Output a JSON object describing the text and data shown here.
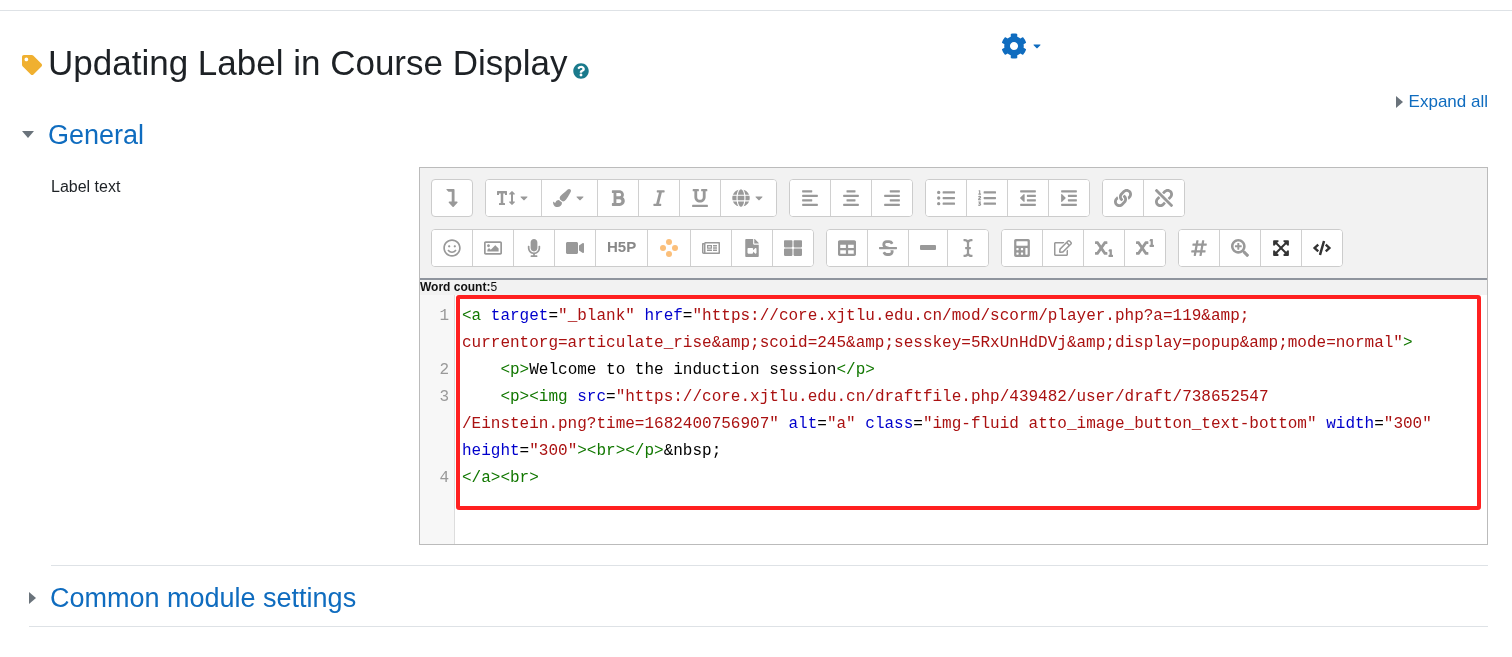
{
  "page": {
    "title": "Updating Label in Course Display"
  },
  "expand_all": "Expand all",
  "sections": [
    {
      "title": "General",
      "expanded": true,
      "fields": [
        {
          "label": "Label text",
          "editor": {
            "h5p_label": "H5P",
            "word_count_label": "Word count:",
            "word_count": "5",
            "highlighted": true,
            "code_lines": [
              {
                "number": "1",
                "rows": [
                  {
                    "tokens": [
                      {
                        "kind": "tag",
                        "text": "<a"
                      },
                      {
                        "kind": "attr",
                        "text": " target"
                      },
                      {
                        "kind": "text",
                        "text": "="
                      },
                      {
                        "kind": "value",
                        "text": "\"_blank\""
                      },
                      {
                        "kind": "attr",
                        "text": " href"
                      },
                      {
                        "kind": "text",
                        "text": "="
                      },
                      {
                        "kind": "value",
                        "text": "\"https://core.xjtlu.edu.cn/mod/scorm/player.php?a=119&amp;"
                      }
                    ]
                  },
                  {
                    "tokens": [
                      {
                        "kind": "value",
                        "text": "currentorg=articulate_rise&amp;scoid=245&amp;sesskey=5RxUnHdDVj&amp;display=popup&amp;mode=normal\""
                      },
                      {
                        "kind": "tag",
                        "text": ">"
                      }
                    ]
                  }
                ]
              },
              {
                "number": "2",
                "rows": [
                  {
                    "tokens": [
                      {
                        "kind": "tag",
                        "text": "    <p>"
                      },
                      {
                        "kind": "text",
                        "text": "Welcome to the induction session"
                      },
                      {
                        "kind": "tag",
                        "text": "</p>"
                      }
                    ]
                  }
                ]
              },
              {
                "number": "3",
                "rows": [
                  {
                    "tokens": [
                      {
                        "kind": "tag",
                        "text": "    <p><img"
                      },
                      {
                        "kind": "attr",
                        "text": " src"
                      },
                      {
                        "kind": "text",
                        "text": "="
                      },
                      {
                        "kind": "value",
                        "text": "\"https://core.xjtlu.edu.cn/draftfile.php/439482/user/draft/738652547"
                      }
                    ]
                  },
                  {
                    "tokens": [
                      {
                        "kind": "value",
                        "text": "/Einstein.png?time=1682400756907\""
                      },
                      {
                        "kind": "attr",
                        "text": " alt"
                      },
                      {
                        "kind": "text",
                        "text": "="
                      },
                      {
                        "kind": "value",
                        "text": "\"a\""
                      },
                      {
                        "kind": "attr",
                        "text": " class"
                      },
                      {
                        "kind": "text",
                        "text": "="
                      },
                      {
                        "kind": "value",
                        "text": "\"img-fluid atto_image_button_text-bottom\""
                      },
                      {
                        "kind": "attr",
                        "text": " width"
                      },
                      {
                        "kind": "text",
                        "text": "="
                      },
                      {
                        "kind": "value",
                        "text": "\"300\""
                      }
                    ]
                  },
                  {
                    "tokens": [
                      {
                        "kind": "attr",
                        "text": "height"
                      },
                      {
                        "kind": "text",
                        "text": "="
                      },
                      {
                        "kind": "value",
                        "text": "\"300\""
                      },
                      {
                        "kind": "tag",
                        "text": "><br></p>"
                      },
                      {
                        "kind": "text",
                        "text": "&nbsp;"
                      }
                    ]
                  }
                ]
              },
              {
                "number": "4",
                "rows": [
                  {
                    "tokens": [
                      {
                        "kind": "tag",
                        "text": "</a><br>"
                      }
                    ]
                  }
                ]
              }
            ]
          }
        }
      ]
    },
    {
      "title": "Common module settings",
      "expanded": false
    }
  ]
}
